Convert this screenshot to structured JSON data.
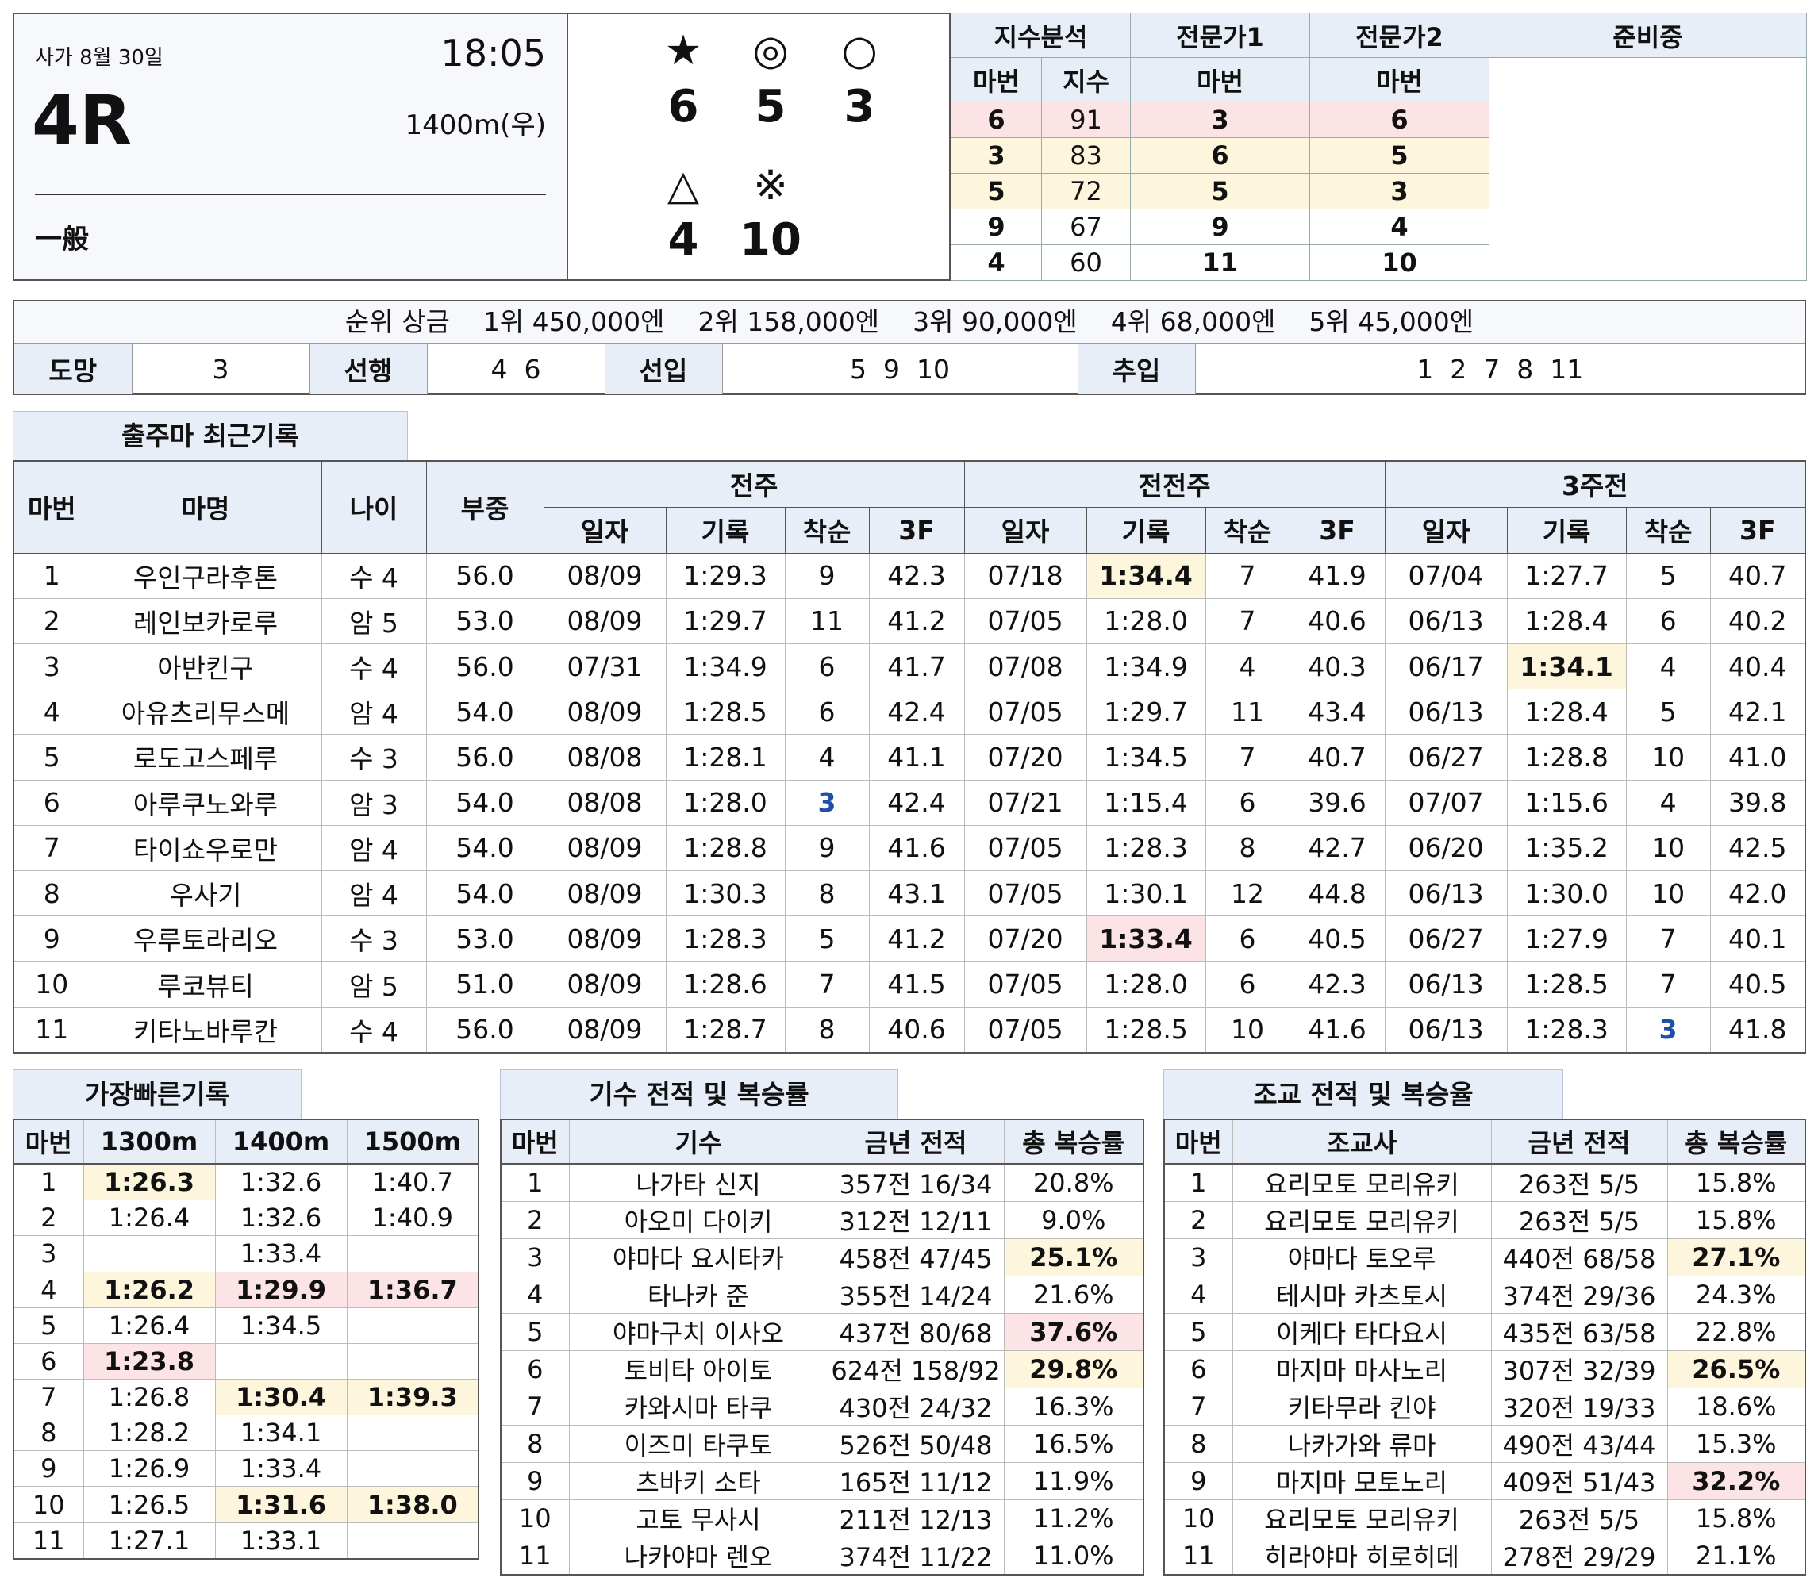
{
  "race": {
    "venue_date": "사가 8월 30일",
    "time": "18:05",
    "race_no": "4R",
    "distance": "1400m(우)",
    "class": "一般"
  },
  "predictions": {
    "star_symbol": "★",
    "star": "6",
    "double_circle_symbol": "◎",
    "double_circle": "5",
    "circle_symbol": "○",
    "circle": "3",
    "triangle_symbol": "△",
    "triangle": "4",
    "mark_symbol": "※",
    "mark": "10"
  },
  "index": {
    "title": "지수분석",
    "expert1": "전문가1",
    "expert2": "전문가2",
    "preparing": "준비중",
    "col_horse": "마번",
    "col_index": "지수",
    "rows": [
      {
        "no": "6",
        "idx": "91",
        "e1": "3",
        "e2": "6"
      },
      {
        "no": "3",
        "idx": "83",
        "e1": "6",
        "e2": "5"
      },
      {
        "no": "5",
        "idx": "72",
        "e1": "5",
        "e2": "3"
      },
      {
        "no": "9",
        "idx": "67",
        "e1": "9",
        "e2": "4"
      },
      {
        "no": "4",
        "idx": "60",
        "e1": "11",
        "e2": "10"
      }
    ]
  },
  "prize": {
    "label": "순위 상금",
    "p1": "1위 450,000엔",
    "p2": "2위 158,000엔",
    "p3": "3위 90,000엔",
    "p4": "4위 68,000엔",
    "p5": "5위 45,000엔"
  },
  "running_style": {
    "escape_label": "도망",
    "escape": "3",
    "lead_label": "선행",
    "lead": "4  6",
    "stalker_label": "선입",
    "stalker": "5  9  10",
    "closer_label": "추입",
    "closer": "1  2  7  8  11"
  },
  "records": {
    "title": "출주마 최근기록",
    "h_no": "마번",
    "h_name": "마명",
    "h_age": "나이",
    "h_weight": "부중",
    "h_prev1": "전주",
    "h_prev2": "전전주",
    "h_prev3": "3주전",
    "h_date": "일자",
    "h_time": "기록",
    "h_rank": "착순",
    "h_3f": "3F",
    "rows": [
      {
        "no": "1",
        "name": "우인구라후톤",
        "age": "수 4",
        "wt": "56.0",
        "d1": "08/09",
        "t1": "1:29.3",
        "r1": "9",
        "f1": "42.3",
        "d2": "07/18",
        "t2": "1:34.4",
        "r2": "7",
        "f2": "41.9",
        "d3": "07/04",
        "t3": "1:27.7",
        "r3": "5",
        "f3": "40.7"
      },
      {
        "no": "2",
        "name": "레인보카로루",
        "age": "암 5",
        "wt": "53.0",
        "d1": "08/09",
        "t1": "1:29.7",
        "r1": "11",
        "f1": "41.2",
        "d2": "07/05",
        "t2": "1:28.0",
        "r2": "7",
        "f2": "40.6",
        "d3": "06/13",
        "t3": "1:28.4",
        "r3": "6",
        "f3": "40.2"
      },
      {
        "no": "3",
        "name": "아반킨구",
        "age": "수 4",
        "wt": "56.0",
        "d1": "07/31",
        "t1": "1:34.9",
        "r1": "6",
        "f1": "41.7",
        "d2": "07/08",
        "t2": "1:34.9",
        "r2": "4",
        "f2": "40.3",
        "d3": "06/17",
        "t3": "1:34.1",
        "r3": "4",
        "f3": "40.4"
      },
      {
        "no": "4",
        "name": "아유츠리무스메",
        "age": "암 4",
        "wt": "54.0",
        "d1": "08/09",
        "t1": "1:28.5",
        "r1": "6",
        "f1": "42.4",
        "d2": "07/05",
        "t2": "1:29.7",
        "r2": "11",
        "f2": "43.4",
        "d3": "06/13",
        "t3": "1:28.4",
        "r3": "5",
        "f3": "42.1"
      },
      {
        "no": "5",
        "name": "로도고스페루",
        "age": "수 3",
        "wt": "56.0",
        "d1": "08/08",
        "t1": "1:28.1",
        "r1": "4",
        "f1": "41.1",
        "d2": "07/20",
        "t2": "1:34.5",
        "r2": "7",
        "f2": "40.7",
        "d3": "06/27",
        "t3": "1:28.8",
        "r3": "10",
        "f3": "41.0"
      },
      {
        "no": "6",
        "name": "아루쿠노와루",
        "age": "암 3",
        "wt": "54.0",
        "d1": "08/08",
        "t1": "1:28.0",
        "r1": "3",
        "f1": "42.4",
        "d2": "07/21",
        "t2": "1:15.4",
        "r2": "6",
        "f2": "39.6",
        "d3": "07/07",
        "t3": "1:15.6",
        "r3": "4",
        "f3": "39.8"
      },
      {
        "no": "7",
        "name": "타이쇼우로만",
        "age": "암 4",
        "wt": "54.0",
        "d1": "08/09",
        "t1": "1:28.8",
        "r1": "9",
        "f1": "41.6",
        "d2": "07/05",
        "t2": "1:28.3",
        "r2": "8",
        "f2": "42.7",
        "d3": "06/20",
        "t3": "1:35.2",
        "r3": "10",
        "f3": "42.5"
      },
      {
        "no": "8",
        "name": "우사기",
        "age": "암 4",
        "wt": "54.0",
        "d1": "08/09",
        "t1": "1:30.3",
        "r1": "8",
        "f1": "43.1",
        "d2": "07/05",
        "t2": "1:30.1",
        "r2": "12",
        "f2": "44.8",
        "d3": "06/13",
        "t3": "1:30.0",
        "r3": "10",
        "f3": "42.0"
      },
      {
        "no": "9",
        "name": "우루토라리오",
        "age": "수 3",
        "wt": "53.0",
        "d1": "08/09",
        "t1": "1:28.3",
        "r1": "5",
        "f1": "41.2",
        "d2": "07/20",
        "t2": "1:33.4",
        "r2": "6",
        "f2": "40.5",
        "d3": "06/27",
        "t3": "1:27.9",
        "r3": "7",
        "f3": "40.1"
      },
      {
        "no": "10",
        "name": "루코뷰티",
        "age": "암 5",
        "wt": "51.0",
        "d1": "08/09",
        "t1": "1:28.6",
        "r1": "7",
        "f1": "41.5",
        "d2": "07/05",
        "t2": "1:28.0",
        "r2": "6",
        "f2": "42.3",
        "d3": "06/13",
        "t3": "1:28.5",
        "r3": "7",
        "f3": "40.5"
      },
      {
        "no": "11",
        "name": "키타노바루칸",
        "age": "수 4",
        "wt": "56.0",
        "d1": "08/09",
        "t1": "1:28.7",
        "r1": "8",
        "f1": "40.6",
        "d2": "07/05",
        "t2": "1:28.5",
        "r2": "10",
        "f2": "41.6",
        "d3": "06/13",
        "t3": "1:28.3",
        "r3": "3",
        "f3": "41.8"
      }
    ]
  },
  "fastest": {
    "title": "가장빠른기록",
    "h_no": "마번",
    "h_1300": "1300m",
    "h_1400": "1400m",
    "h_1500": "1500m",
    "rows": [
      {
        "no": "1",
        "a": "1:26.3",
        "b": "1:32.6",
        "c": "1:40.7"
      },
      {
        "no": "2",
        "a": "1:26.4",
        "b": "1:32.6",
        "c": "1:40.9"
      },
      {
        "no": "3",
        "a": "",
        "b": "1:33.4",
        "c": ""
      },
      {
        "no": "4",
        "a": "1:26.2",
        "b": "1:29.9",
        "c": "1:36.7"
      },
      {
        "no": "5",
        "a": "1:26.4",
        "b": "1:34.5",
        "c": ""
      },
      {
        "no": "6",
        "a": "1:23.8",
        "b": "",
        "c": ""
      },
      {
        "no": "7",
        "a": "1:26.8",
        "b": "1:30.4",
        "c": "1:39.3"
      },
      {
        "no": "8",
        "a": "1:28.2",
        "b": "1:34.1",
        "c": ""
      },
      {
        "no": "9",
        "a": "1:26.9",
        "b": "1:33.4",
        "c": ""
      },
      {
        "no": "10",
        "a": "1:26.5",
        "b": "1:31.6",
        "c": "1:38.0"
      },
      {
        "no": "11",
        "a": "1:27.1",
        "b": "1:33.1",
        "c": ""
      }
    ]
  },
  "jockey": {
    "title": "기수 전적 및 복승률",
    "h_no": "마번",
    "h_name": "기수",
    "h_rec": "금년 전적",
    "h_rate": "총 복승률",
    "rows": [
      {
        "no": "1",
        "name": "나가타 신지",
        "rec": "357전 16/34",
        "rate": "20.8%"
      },
      {
        "no": "2",
        "name": "아오미 다이키",
        "rec": "312전 12/11",
        "rate": "9.0%"
      },
      {
        "no": "3",
        "name": "야마다 요시타카",
        "rec": "458전 47/45",
        "rate": "25.1%"
      },
      {
        "no": "4",
        "name": "타나카 준",
        "rec": "355전 14/24",
        "rate": "21.6%"
      },
      {
        "no": "5",
        "name": "야마구치 이사오",
        "rec": "437전 80/68",
        "rate": "37.6%"
      },
      {
        "no": "6",
        "name": "토비타 아이토",
        "rec": "624전 158/92",
        "rate": "29.8%"
      },
      {
        "no": "7",
        "name": "카와시마 타쿠",
        "rec": "430전 24/32",
        "rate": "16.3%"
      },
      {
        "no": "8",
        "name": "이즈미 타쿠토",
        "rec": "526전 50/48",
        "rate": "16.5%"
      },
      {
        "no": "9",
        "name": "츠바키 소타",
        "rec": "165전 11/12",
        "rate": "11.9%"
      },
      {
        "no": "10",
        "name": "고토 무사시",
        "rec": "211전 12/13",
        "rate": "11.2%"
      },
      {
        "no": "11",
        "name": "나카야마 렌오",
        "rec": "374전 11/22",
        "rate": "11.0%"
      }
    ]
  },
  "trainer": {
    "title": "조교 전적 및 복승율",
    "h_no": "마번",
    "h_name": "조교사",
    "h_rec": "금년 전적",
    "h_rate": "총 복승률",
    "rows": [
      {
        "no": "1",
        "name": "요리모토 모리유키",
        "rec": "263전 5/5",
        "rate": "15.8%"
      },
      {
        "no": "2",
        "name": "요리모토 모리유키",
        "rec": "263전 5/5",
        "rate": "15.8%"
      },
      {
        "no": "3",
        "name": "야마다 토오루",
        "rec": "440전 68/58",
        "rate": "27.1%"
      },
      {
        "no": "4",
        "name": "테시마 카츠토시",
        "rec": "374전 29/36",
        "rate": "24.3%"
      },
      {
        "no": "5",
        "name": "이케다 타다요시",
        "rec": "435전 63/58",
        "rate": "22.8%"
      },
      {
        "no": "6",
        "name": "마지마 마사노리",
        "rec": "307전 32/39",
        "rate": "26.5%"
      },
      {
        "no": "7",
        "name": "키타무라 킨야",
        "rec": "320전 19/33",
        "rate": "18.6%"
      },
      {
        "no": "8",
        "name": "나카가와 류마",
        "rec": "490전 43/44",
        "rate": "15.3%"
      },
      {
        "no": "9",
        "name": "마지마 모토노리",
        "rec": "409전 51/43",
        "rate": "32.2%"
      },
      {
        "no": "10",
        "name": "요리모토 모리유키",
        "rec": "263전 5/5",
        "rate": "15.8%"
      },
      {
        "no": "11",
        "name": "히라야마 히로히데",
        "rec": "278전 29/29",
        "rate": "21.1%"
      }
    ]
  },
  "highlight_colors": {
    "pink": "#fbe3e6",
    "yellow": "#fdf5dc",
    "blue_text": "#1f4fa6",
    "header_bg": "#e8eef7"
  }
}
